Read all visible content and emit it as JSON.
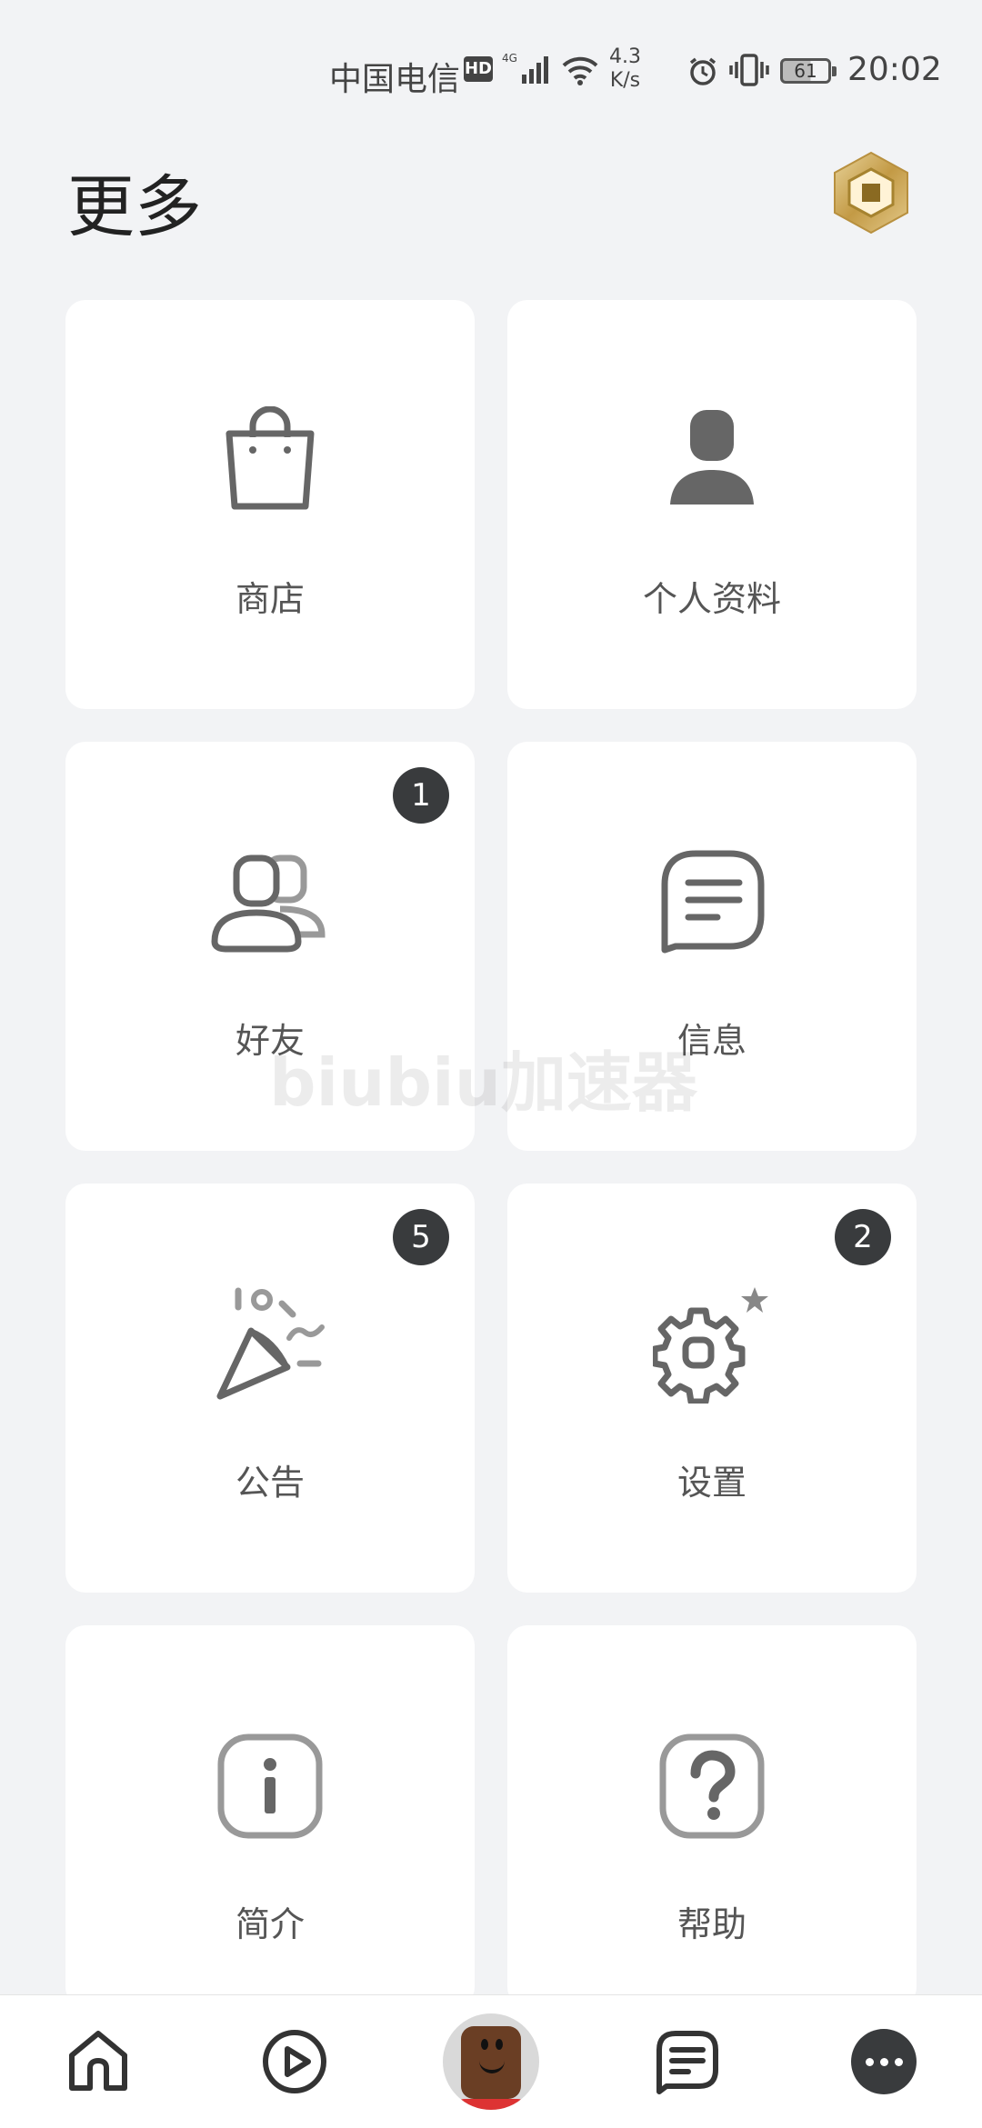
{
  "status_bar": {
    "carrier": "中国电信",
    "hd": "HD",
    "network": "4G",
    "speed_value": "4.3",
    "speed_unit": "K/s",
    "battery": "61",
    "time": "20:02"
  },
  "header": {
    "title": "更多"
  },
  "tiles": [
    {
      "label": "商店",
      "icon": "shopping-bag-icon"
    },
    {
      "label": "个人资料",
      "icon": "profile-icon"
    },
    {
      "label": "好友",
      "icon": "friends-icon",
      "badge": "1"
    },
    {
      "label": "信息",
      "icon": "message-icon"
    },
    {
      "label": "公告",
      "icon": "party-popper-icon",
      "badge": "5"
    },
    {
      "label": "设置",
      "icon": "gear-icon",
      "badge": "2"
    },
    {
      "label": "简介",
      "icon": "info-icon"
    },
    {
      "label": "帮助",
      "icon": "help-icon"
    }
  ],
  "watermark": "biubiu加速器",
  "bottom_nav": [
    {
      "name": "home",
      "icon": "home-icon"
    },
    {
      "name": "discover",
      "icon": "play-icon"
    },
    {
      "name": "avatar",
      "icon": "avatar-icon"
    },
    {
      "name": "chat",
      "icon": "chat-icon"
    },
    {
      "name": "more",
      "icon": "more-icon",
      "active": true
    }
  ],
  "colors": {
    "background": "#f2f3f5",
    "tile": "#ffffff",
    "badge": "#393b3d",
    "icon": "#666666",
    "robux_gold": "#c9a85a"
  }
}
